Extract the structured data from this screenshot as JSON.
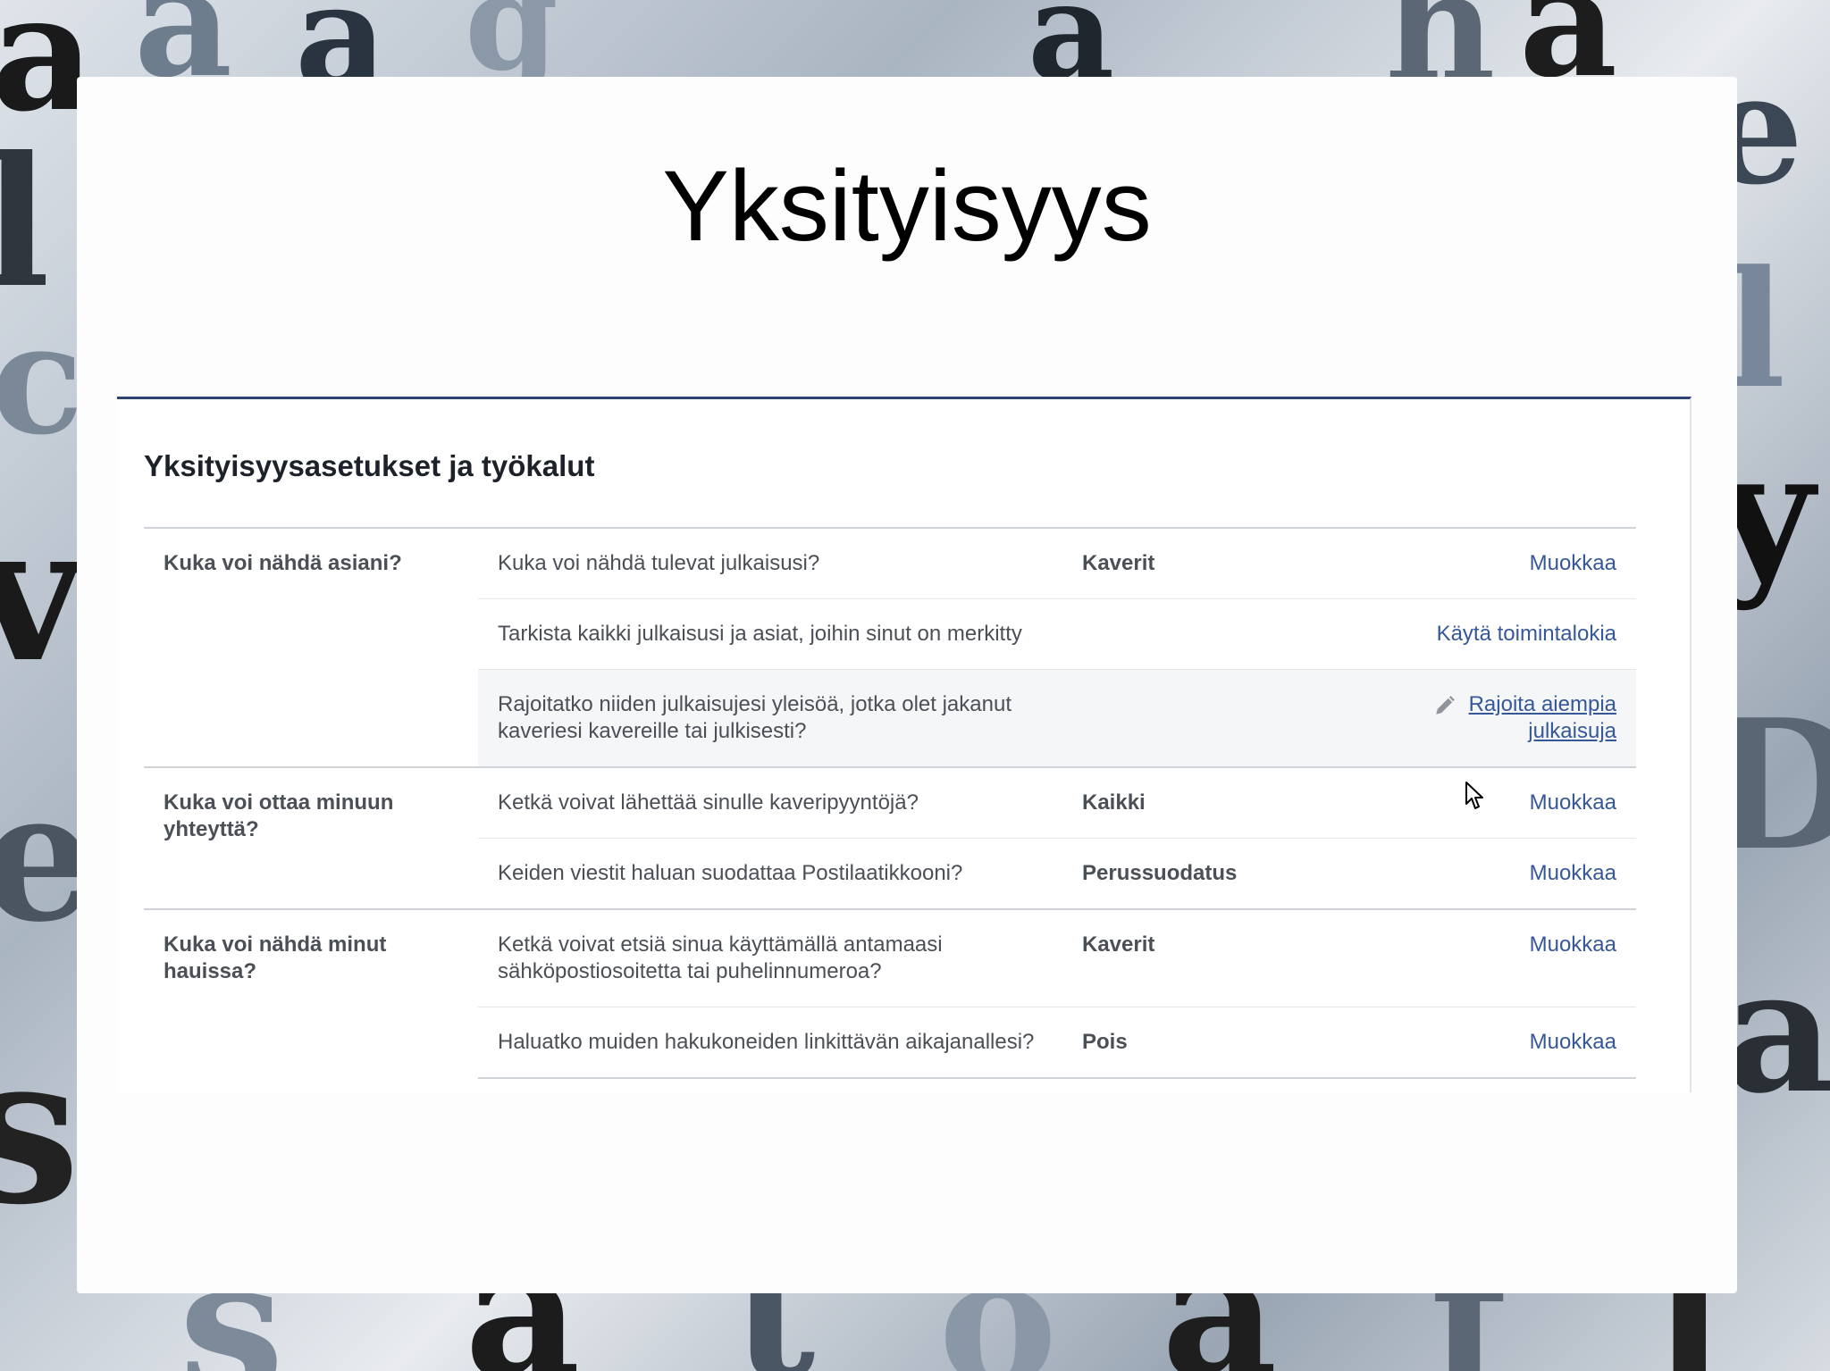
{
  "slide": {
    "title": "Yksityisyys"
  },
  "panel": {
    "heading": "Yksityisyysasetukset ja työkalut",
    "groups": [
      {
        "category": "Kuka voi nähdä asiani?",
        "rows": [
          {
            "question": "Kuka voi nähdä tulevat julkaisusi?",
            "value": "Kaverit",
            "action": "Muokkaa"
          },
          {
            "question": "Tarkista kaikki julkaisusi ja asiat, joihin sinut on merkitty",
            "value": "",
            "action": "Käytä toimintalokia"
          },
          {
            "question": "Rajoitatko niiden julkaisujesi yleisöä, jotka olet jakanut kaveriesi kavereille tai julkisesti?",
            "value": "",
            "action": "Rajoita aiempia julkaisuja"
          }
        ]
      },
      {
        "category": "Kuka voi ottaa minuun yhteyttä?",
        "rows": [
          {
            "question": "Ketkä voivat lähettää sinulle kaveripyyntöjä?",
            "value": "Kaikki",
            "action": "Muokkaa"
          },
          {
            "question": "Keiden viestit haluan suodattaa Postilaatikkooni?",
            "value": "Perussuodatus",
            "action": "Muokkaa"
          }
        ]
      },
      {
        "category": "Kuka voi nähdä minut hauissa?",
        "rows": [
          {
            "question": "Ketkä voivat etsiä sinua käyttämällä antamaasi sähköpostiosoitetta tai puhelinnumeroa?",
            "value": "Kaverit",
            "action": "Muokkaa"
          },
          {
            "question": "Haluatko muiden hakukoneiden linkittävän aikajanallesi?",
            "value": "Pois",
            "action": "Muokkaa"
          }
        ]
      }
    ]
  },
  "colors": {
    "link": "#365899",
    "top_border": "#2d4373",
    "highlight_row": "#f5f6f7"
  },
  "icons": {
    "edit": "pencil-icon",
    "pointer": "mouse-cursor-icon"
  }
}
